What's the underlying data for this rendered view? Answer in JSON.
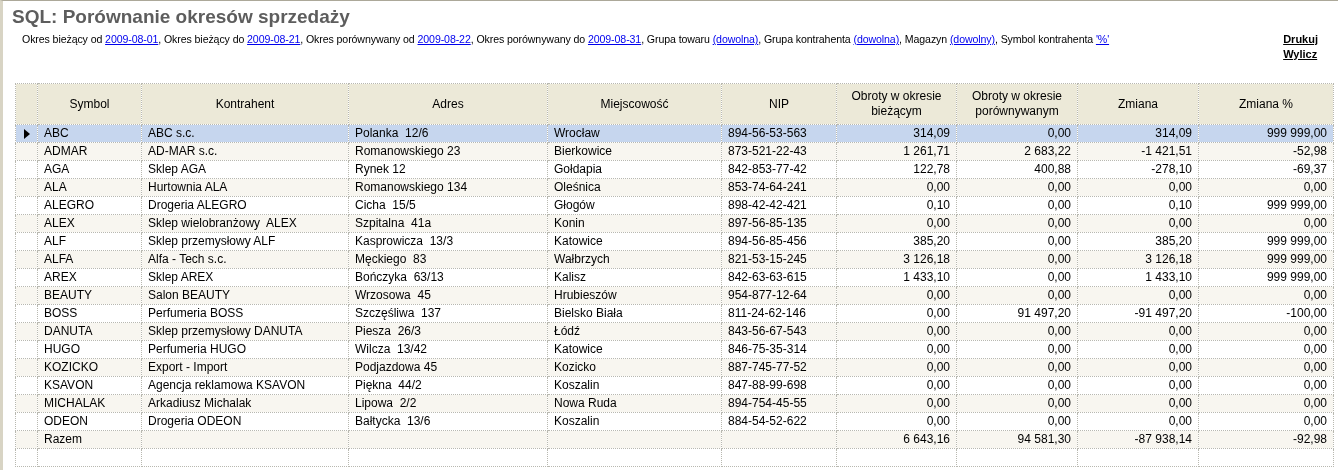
{
  "title": "SQL: Porównanie okresów sprzedaży",
  "filters": [
    {
      "label": "Okres bieżący od",
      "value": "2009-08-01"
    },
    {
      "label": "Okres bieżący do",
      "value": "2009-08-21"
    },
    {
      "label": "Okres porównywany od",
      "value": "2009-08-22"
    },
    {
      "label": "Okres porównywany do",
      "value": "2009-08-31"
    },
    {
      "label": "Grupa towaru",
      "value": "(dowolna)"
    },
    {
      "label": "Grupa kontrahenta",
      "value": "(dowolna)"
    },
    {
      "label": "Magazyn",
      "value": "(dowolny)"
    },
    {
      "label": "Symbol kontrahenta",
      "value": "'%'"
    }
  ],
  "filter_separator": ", ",
  "actions": [
    "Drukuj",
    "Wylicz"
  ],
  "columns": [
    {
      "label": "Symbol",
      "kind": "text"
    },
    {
      "label": "Kontrahent",
      "kind": "text"
    },
    {
      "label": "Adres",
      "kind": "text"
    },
    {
      "label": "Miejscowość",
      "kind": "text"
    },
    {
      "label": "NIP",
      "kind": "text"
    },
    {
      "label": "Obroty w okresie bieżącym",
      "kind": "number"
    },
    {
      "label": "Obroty w okresie porównywanym",
      "kind": "number"
    },
    {
      "label": "Zmiana",
      "kind": "number"
    },
    {
      "label": "Zmiana %",
      "kind": "number"
    }
  ],
  "rows": [
    {
      "selected": true,
      "cells": [
        "ABC",
        "ABC s.c.",
        "Polanka  12/6",
        "Wrocław",
        "894-56-53-563",
        "314,09",
        "0,00",
        "314,09",
        "999 999,00"
      ]
    },
    {
      "selected": false,
      "cells": [
        "ADMAR",
        "AD-MAR s.c.",
        "Romanowskiego 23",
        "Bierkowice",
        "873-521-22-43",
        "1 261,71",
        "2 683,22",
        "-1 421,51",
        "-52,98"
      ]
    },
    {
      "selected": false,
      "cells": [
        "AGA",
        "Sklep AGA",
        "Rynek 12",
        "Gołdapia",
        "842-853-77-42",
        "122,78",
        "400,88",
        "-278,10",
        "-69,37"
      ]
    },
    {
      "selected": false,
      "cells": [
        "ALA",
        "Hurtownia ALA",
        "Romanowskiego 134",
        "Oleśnica",
        "853-74-64-241",
        "0,00",
        "0,00",
        "0,00",
        "0,00"
      ]
    },
    {
      "selected": false,
      "cells": [
        "ALEGRO",
        "Drogeria ALEGRO",
        "Cicha  15/5",
        "Głogów",
        "898-42-42-421",
        "0,10",
        "0,00",
        "0,10",
        "999 999,00"
      ]
    },
    {
      "selected": false,
      "cells": [
        "ALEX",
        "Sklep wielobranżowy  ALEX",
        "Szpitalna  41a",
        "Konin",
        "897-56-85-135",
        "0,00",
        "0,00",
        "0,00",
        "0,00"
      ]
    },
    {
      "selected": false,
      "cells": [
        "ALF",
        "Sklep przemysłowy ALF",
        "Kasprowicza  13/3",
        "Katowice",
        "894-56-85-456",
        "385,20",
        "0,00",
        "385,20",
        "999 999,00"
      ]
    },
    {
      "selected": false,
      "cells": [
        "ALFA",
        "Alfa - Tech s.c.",
        "Męckiego  83",
        "Wałbrzych",
        "821-53-15-245",
        "3 126,18",
        "0,00",
        "3 126,18",
        "999 999,00"
      ]
    },
    {
      "selected": false,
      "cells": [
        "AREX",
        "Sklep AREX",
        "Bończyka  63/13",
        "Kalisz",
        "842-63-63-615",
        "1 433,10",
        "0,00",
        "1 433,10",
        "999 999,00"
      ]
    },
    {
      "selected": false,
      "cells": [
        "BEAUTY",
        "Salon BEAUTY",
        "Wrzosowa  45",
        "Hrubieszów",
        "954-877-12-64",
        "0,00",
        "0,00",
        "0,00",
        "0,00"
      ]
    },
    {
      "selected": false,
      "cells": [
        "BOSS",
        "Perfumeria BOSS",
        "Szczęśliwa  137",
        "Bielsko Biała",
        "811-24-62-146",
        "0,00",
        "91 497,20",
        "-91 497,20",
        "-100,00"
      ]
    },
    {
      "selected": false,
      "cells": [
        "DANUTA",
        "Sklep przemysłowy DANUTA",
        "Piesza  26/3",
        "Łódź",
        "843-56-67-543",
        "0,00",
        "0,00",
        "0,00",
        "0,00"
      ]
    },
    {
      "selected": false,
      "cells": [
        "HUGO",
        "Perfumeria HUGO",
        "Wilcza  13/42",
        "Katowice",
        "846-75-35-314",
        "0,00",
        "0,00",
        "0,00",
        "0,00"
      ]
    },
    {
      "selected": false,
      "cells": [
        "KOZICKO",
        "Export - Import",
        "Podjazdowa 45",
        "Kozicko",
        "887-745-77-52",
        "0,00",
        "0,00",
        "0,00",
        "0,00"
      ]
    },
    {
      "selected": false,
      "cells": [
        "KSAVON",
        "Agencja reklamowa KSAVON",
        "Piękna  44/2",
        "Koszalin",
        "847-88-99-698",
        "0,00",
        "0,00",
        "0,00",
        "0,00"
      ]
    },
    {
      "selected": false,
      "cells": [
        "MICHALAK",
        "Arkadiusz Michalak",
        "Lipowa  2/2",
        "Nowa Ruda",
        "894-754-45-55",
        "0,00",
        "0,00",
        "0,00",
        "0,00"
      ]
    },
    {
      "selected": false,
      "cells": [
        "ODEON",
        "Drogeria ODEON",
        "Bałtycka  13/6",
        "Koszalin",
        "884-54-52-622",
        "0,00",
        "0,00",
        "0,00",
        "0,00"
      ]
    }
  ],
  "totals": {
    "label": "Razem",
    "values": [
      "6 643,16",
      "94 581,30",
      "-87 938,14",
      "-92,98"
    ]
  }
}
